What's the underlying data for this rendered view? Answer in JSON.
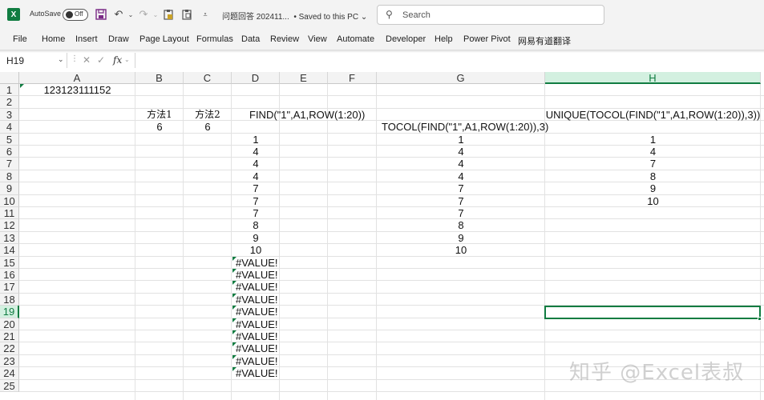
{
  "titlebar": {
    "logo": "X",
    "autosave_label": "AutoSave",
    "autosave_state": "Off",
    "title": "问题回答 202411...",
    "saved_status": "• Saved to this PC",
    "search_placeholder": "Search",
    "icons": [
      "excel-logo",
      "save-icon",
      "undo-icon",
      "redo-icon",
      "paste-special-icon",
      "clipboard-icon",
      "customize-qat-icon"
    ]
  },
  "ribbon": {
    "tabs": [
      "File",
      "Home",
      "Insert",
      "Draw",
      "Page Layout",
      "Formulas",
      "Data",
      "Review",
      "View",
      "Automate",
      "Developer",
      "Help",
      "Power Pivot",
      "网易有道翻译"
    ]
  },
  "formula_bar": {
    "name_box": "H19",
    "fx": "fx",
    "formula": ""
  },
  "columns": [
    "A",
    "B",
    "C",
    "D",
    "E",
    "F",
    "G",
    "H"
  ],
  "selected_column": "H",
  "rows": [
    "1",
    "2",
    "3",
    "4",
    "5",
    "6",
    "7",
    "8",
    "9",
    "10",
    "11",
    "12",
    "13",
    "14",
    "15",
    "16",
    "17",
    "18",
    "19",
    "20",
    "21",
    "22",
    "23",
    "24",
    "25"
  ],
  "selected_row": "19",
  "cells": {
    "A1": "123123111152",
    "B3": "方法1",
    "C3": "方法2",
    "B4": "6",
    "C4": "6",
    "D3": "FIND(\"1\",A1,ROW(1:20))",
    "G4": "TOCOL(FIND(\"1\",A1,ROW(1:20)),3)",
    "H3": "UNIQUE(TOCOL(FIND(\"1\",A1,ROW(1:20)),3))",
    "D_values": [
      "1",
      "4",
      "4",
      "4",
      "7",
      "7",
      "7",
      "8",
      "9",
      "10",
      "#VALUE!",
      "#VALUE!",
      "#VALUE!",
      "#VALUE!",
      "#VALUE!",
      "#VALUE!",
      "#VALUE!",
      "#VALUE!",
      "#VALUE!",
      "#VALUE!"
    ],
    "G_values": [
      "1",
      "4",
      "4",
      "4",
      "7",
      "7",
      "7",
      "8",
      "9",
      "10"
    ],
    "H_values": [
      "1",
      "4",
      "7",
      "8",
      "9",
      "10"
    ]
  },
  "watermark": "知乎 @Excel表叔"
}
